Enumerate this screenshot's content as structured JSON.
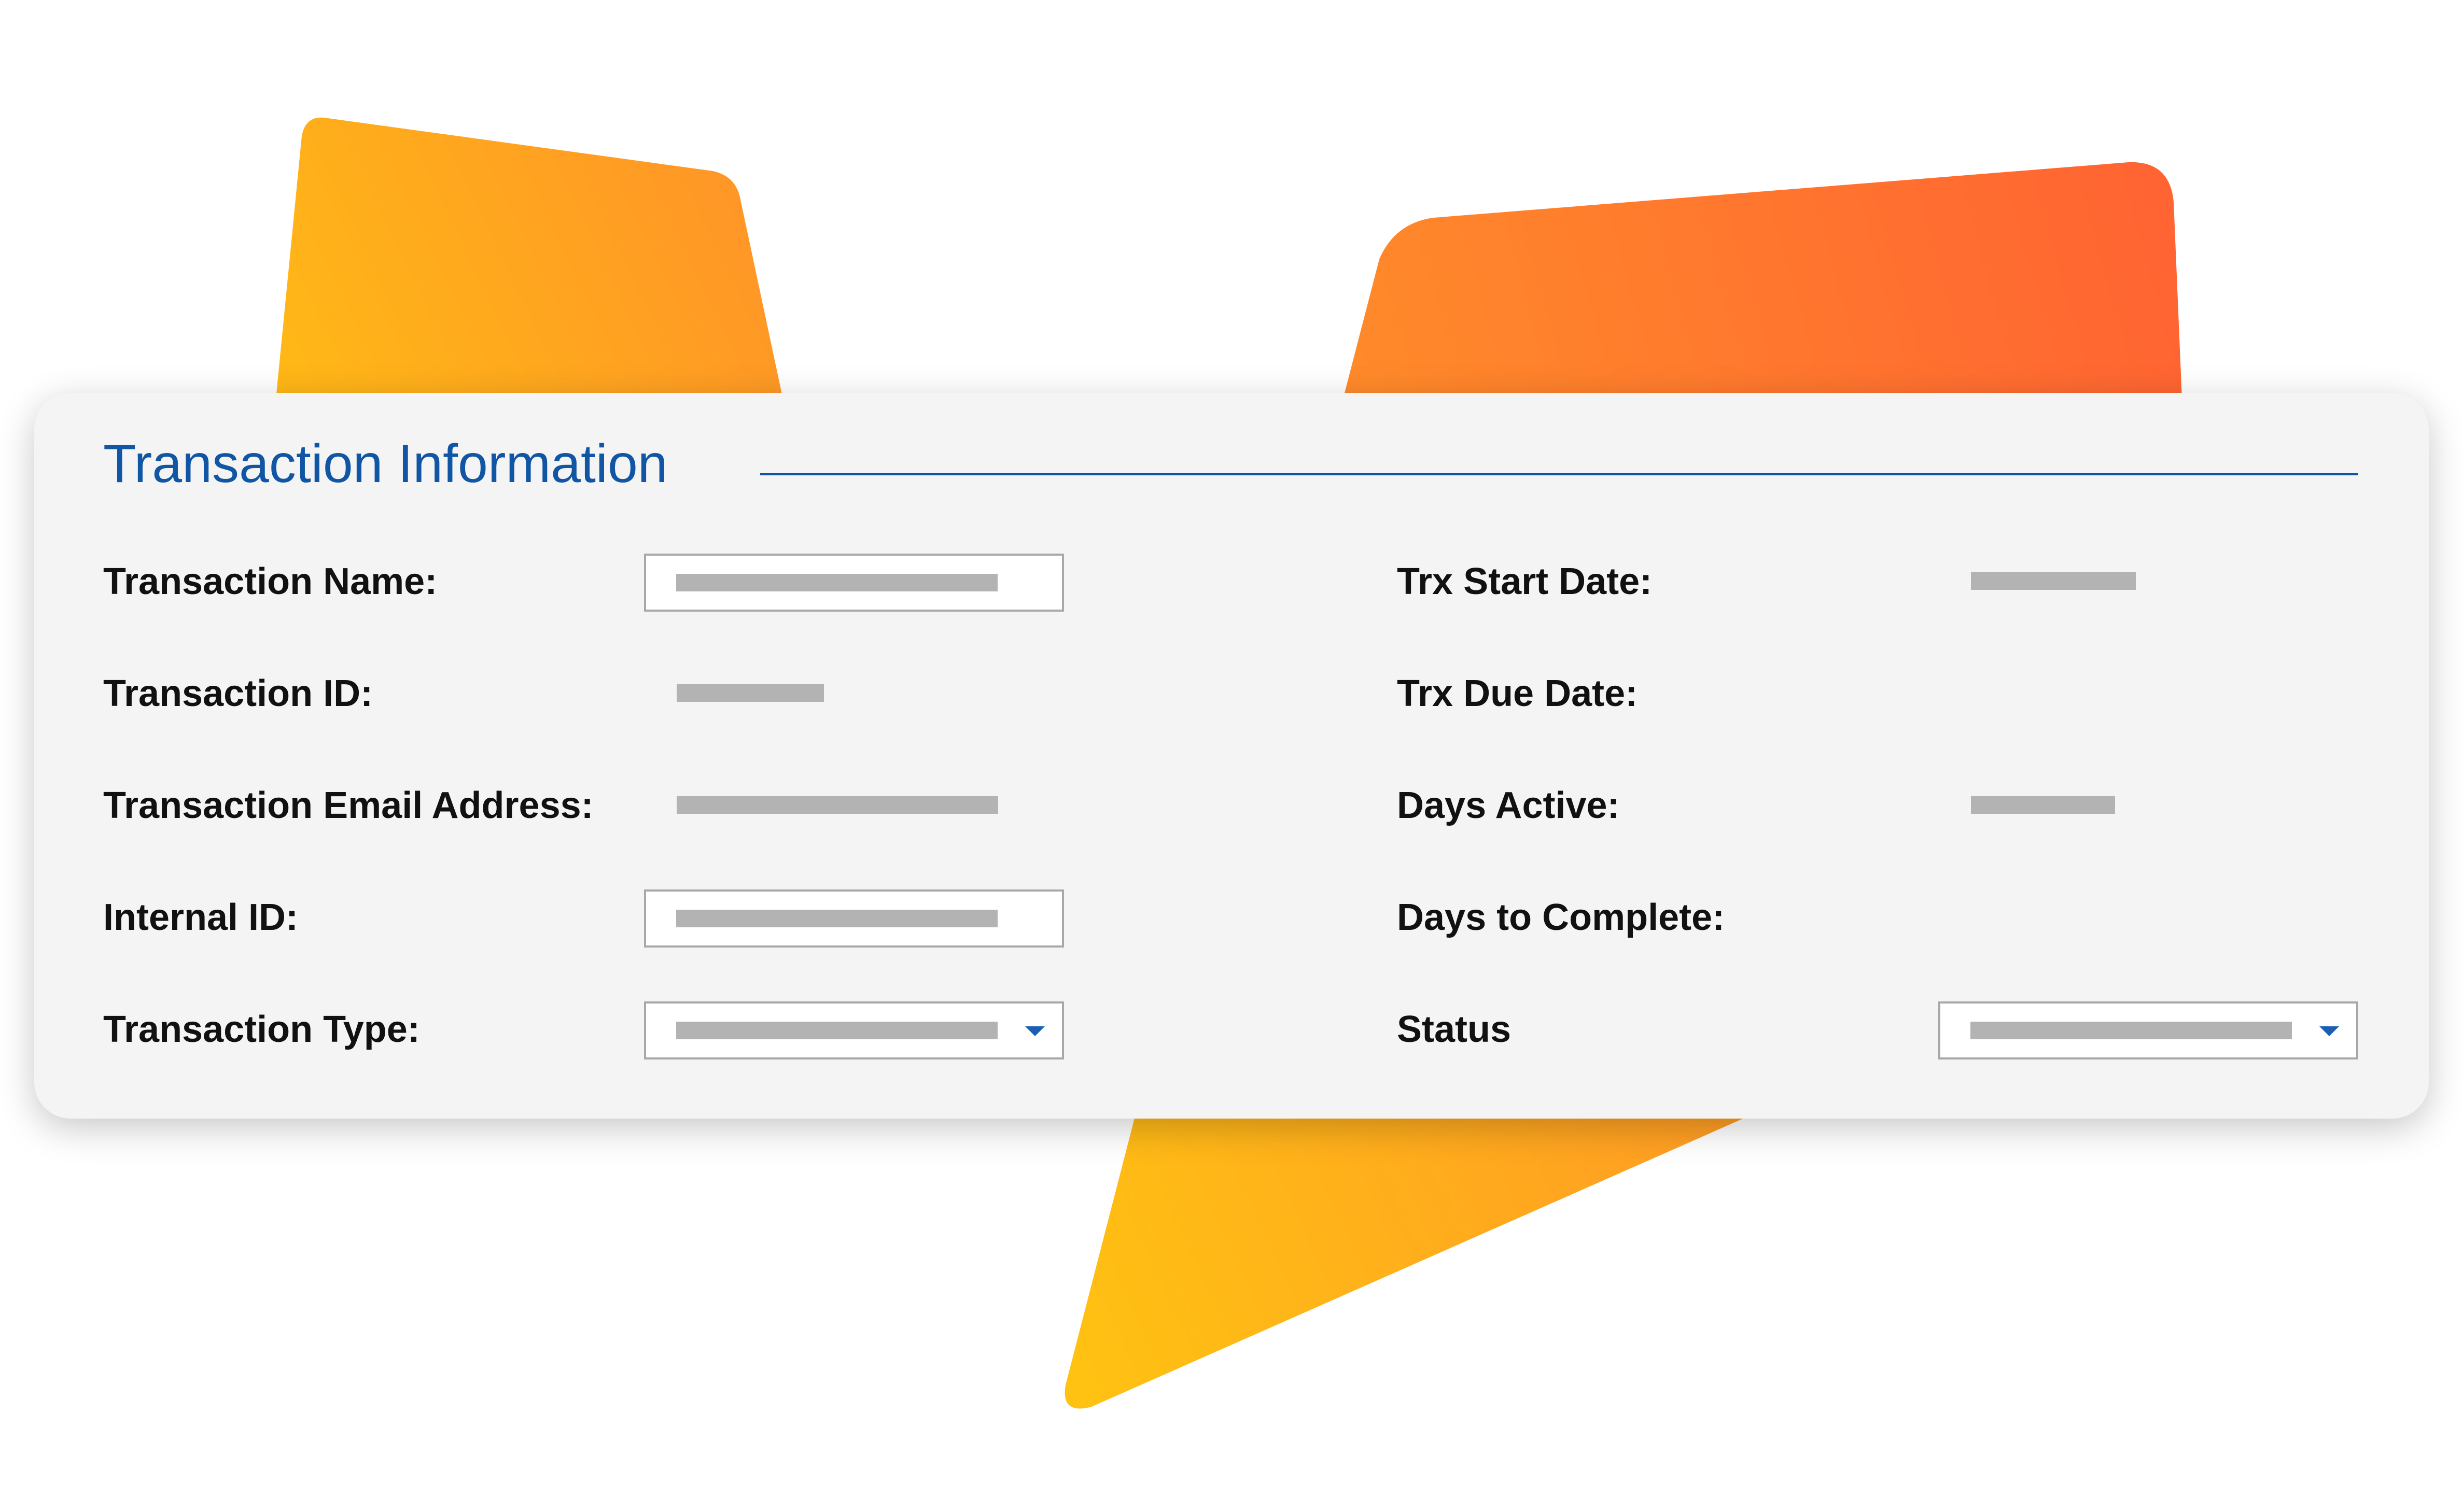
{
  "colors": {
    "title_blue": "#1155a5",
    "label_black": "#111111",
    "panel_background": "#f4f4f4",
    "placeholder_gray": "#b3b3b3",
    "dropdown_arrow_blue": "#1b5fb4",
    "shape_gradient_yellow": "#ffbd14",
    "shape_gradient_orange": "#ff6632"
  },
  "panel": {
    "title": "Transaction Information"
  },
  "fields_left": {
    "transaction_name": {
      "label": "Transaction Name:",
      "control": "text-input"
    },
    "transaction_id": {
      "label": "Transaction ID:",
      "control": "read-only"
    },
    "transaction_email": {
      "label": "Transaction Email Address:",
      "control": "read-only"
    },
    "internal_id": {
      "label": "Internal ID:",
      "control": "text-input"
    },
    "transaction_type": {
      "label": "Transaction Type:",
      "control": "dropdown",
      "icon": "chevron-down-icon"
    }
  },
  "fields_right": {
    "trx_start_date": {
      "label": "Trx Start Date:",
      "control": "read-only"
    },
    "trx_due_date": {
      "label": "Trx Due Date:",
      "control": "empty"
    },
    "days_active": {
      "label": "Days Active:",
      "control": "read-only"
    },
    "days_to_complete": {
      "label": "Days to Complete:",
      "control": "empty"
    },
    "status": {
      "label": "Status",
      "control": "dropdown",
      "icon": "chevron-down-icon"
    }
  }
}
